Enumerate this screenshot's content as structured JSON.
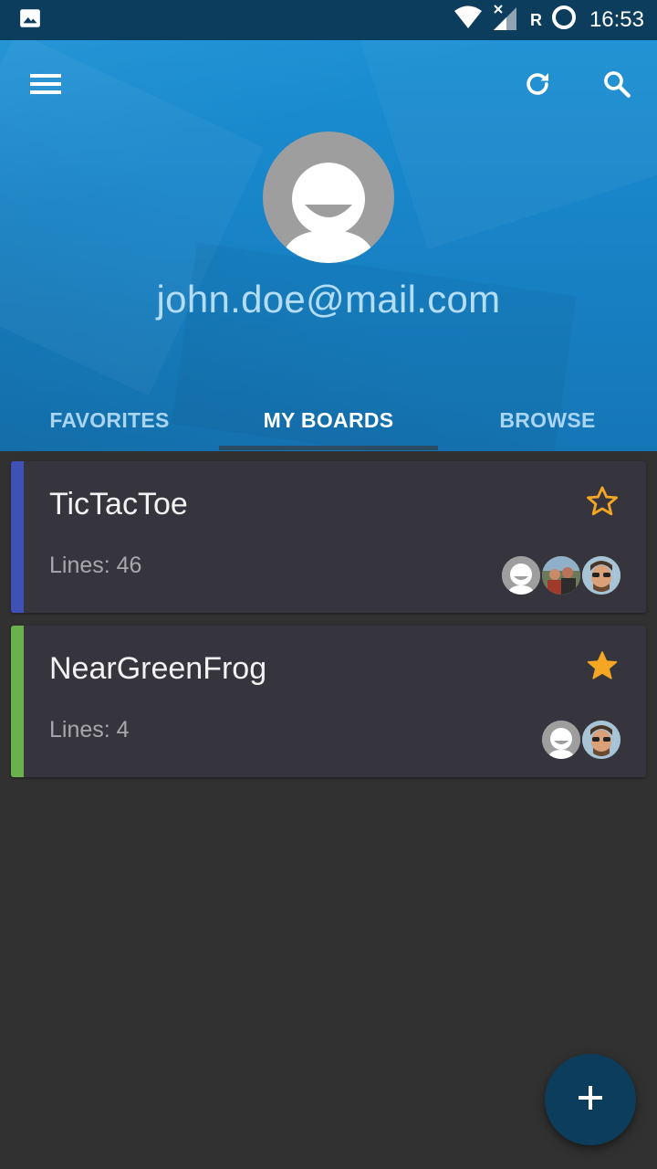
{
  "status_bar": {
    "time": "16:53",
    "roaming": "R",
    "icons": [
      "image-icon",
      "wifi-icon",
      "signal-icon",
      "battery-icon"
    ]
  },
  "header": {
    "email": "john.doe@mail.com",
    "icons": [
      "menu-icon",
      "refresh-icon",
      "search-icon"
    ]
  },
  "tabs": [
    {
      "label": "FAVORITES",
      "active": false
    },
    {
      "label": "MY BOARDS",
      "active": true
    },
    {
      "label": "BROWSE",
      "active": false
    }
  ],
  "boards": [
    {
      "title": "TicTacToe",
      "lines": "Lines: 46",
      "favorite": false,
      "stripe_color": "#3f51b5",
      "members": [
        "default-avatar",
        "group-photo-avatar",
        "sunglasses-man-avatar"
      ]
    },
    {
      "title": "NearGreenFrog",
      "lines": "Lines: 4",
      "favorite": true,
      "stripe_color": "#6ab04c",
      "members": [
        "default-avatar",
        "sunglasses-man-avatar"
      ]
    }
  ],
  "colors": {
    "header_blue": "#1a8fd3",
    "status_bar": "#0d3d5c",
    "star": "#f5a623",
    "background": "#313131",
    "card": "#36353d"
  },
  "fab": {
    "icon": "plus-icon"
  }
}
